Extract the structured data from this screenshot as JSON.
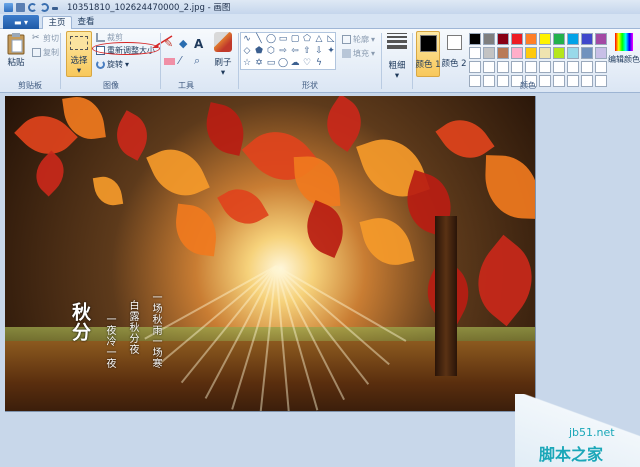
{
  "window": {
    "title": "10351810_102624470000_2.jpg - 画图"
  },
  "tabs": [
    {
      "label": "主页"
    },
    {
      "label": "查看"
    }
  ],
  "ribbon": {
    "clipboard": {
      "paste": "粘贴",
      "cut": "剪切",
      "copy": "复制",
      "group": "剪贴板"
    },
    "image": {
      "select": "选择",
      "crop": "裁剪",
      "resize": "重新调整大小",
      "rotate": "旋转",
      "group": "图像"
    },
    "tools": {
      "group": "工具"
    },
    "brushes": {
      "label": "刷子"
    },
    "shapes": {
      "outline": "轮廓",
      "fill": "填充",
      "group": "形状"
    },
    "size": {
      "label": "粗细"
    },
    "colors": {
      "color1": "颜色 1",
      "color2": "颜色 2",
      "edit": "编辑颜色",
      "group": "颜色",
      "palette": [
        "#000000",
        "#7f7f7f",
        "#880015",
        "#ed1c24",
        "#ff7f27",
        "#fff200",
        "#22b14c",
        "#00a2e8",
        "#3f48cc",
        "#a349a4",
        "#ffffff",
        "#c3c3c3",
        "#b97a57",
        "#ffaec9",
        "#ffc90e",
        "#efe4b0",
        "#b5e61d",
        "#99d9ea",
        "#7092be",
        "#c8bfe7",
        "#ffffff",
        "#ffffff",
        "#ffffff",
        "#ffffff",
        "#ffffff",
        "#ffffff",
        "#ffffff",
        "#ffffff",
        "#ffffff",
        "#ffffff",
        "#ffffff",
        "#ffffff",
        "#ffffff",
        "#ffffff",
        "#ffffff",
        "#ffffff",
        "#ffffff",
        "#ffffff",
        "#ffffff",
        "#ffffff"
      ]
    }
  },
  "canvas": {
    "poem_title": "秋分",
    "poem_lines": [
      "一场秋雨一场寒",
      "白露秋分夜",
      "一夜冷一夜"
    ]
  },
  "watermark": {
    "url": "jb51.net",
    "name": "脚本之家"
  }
}
